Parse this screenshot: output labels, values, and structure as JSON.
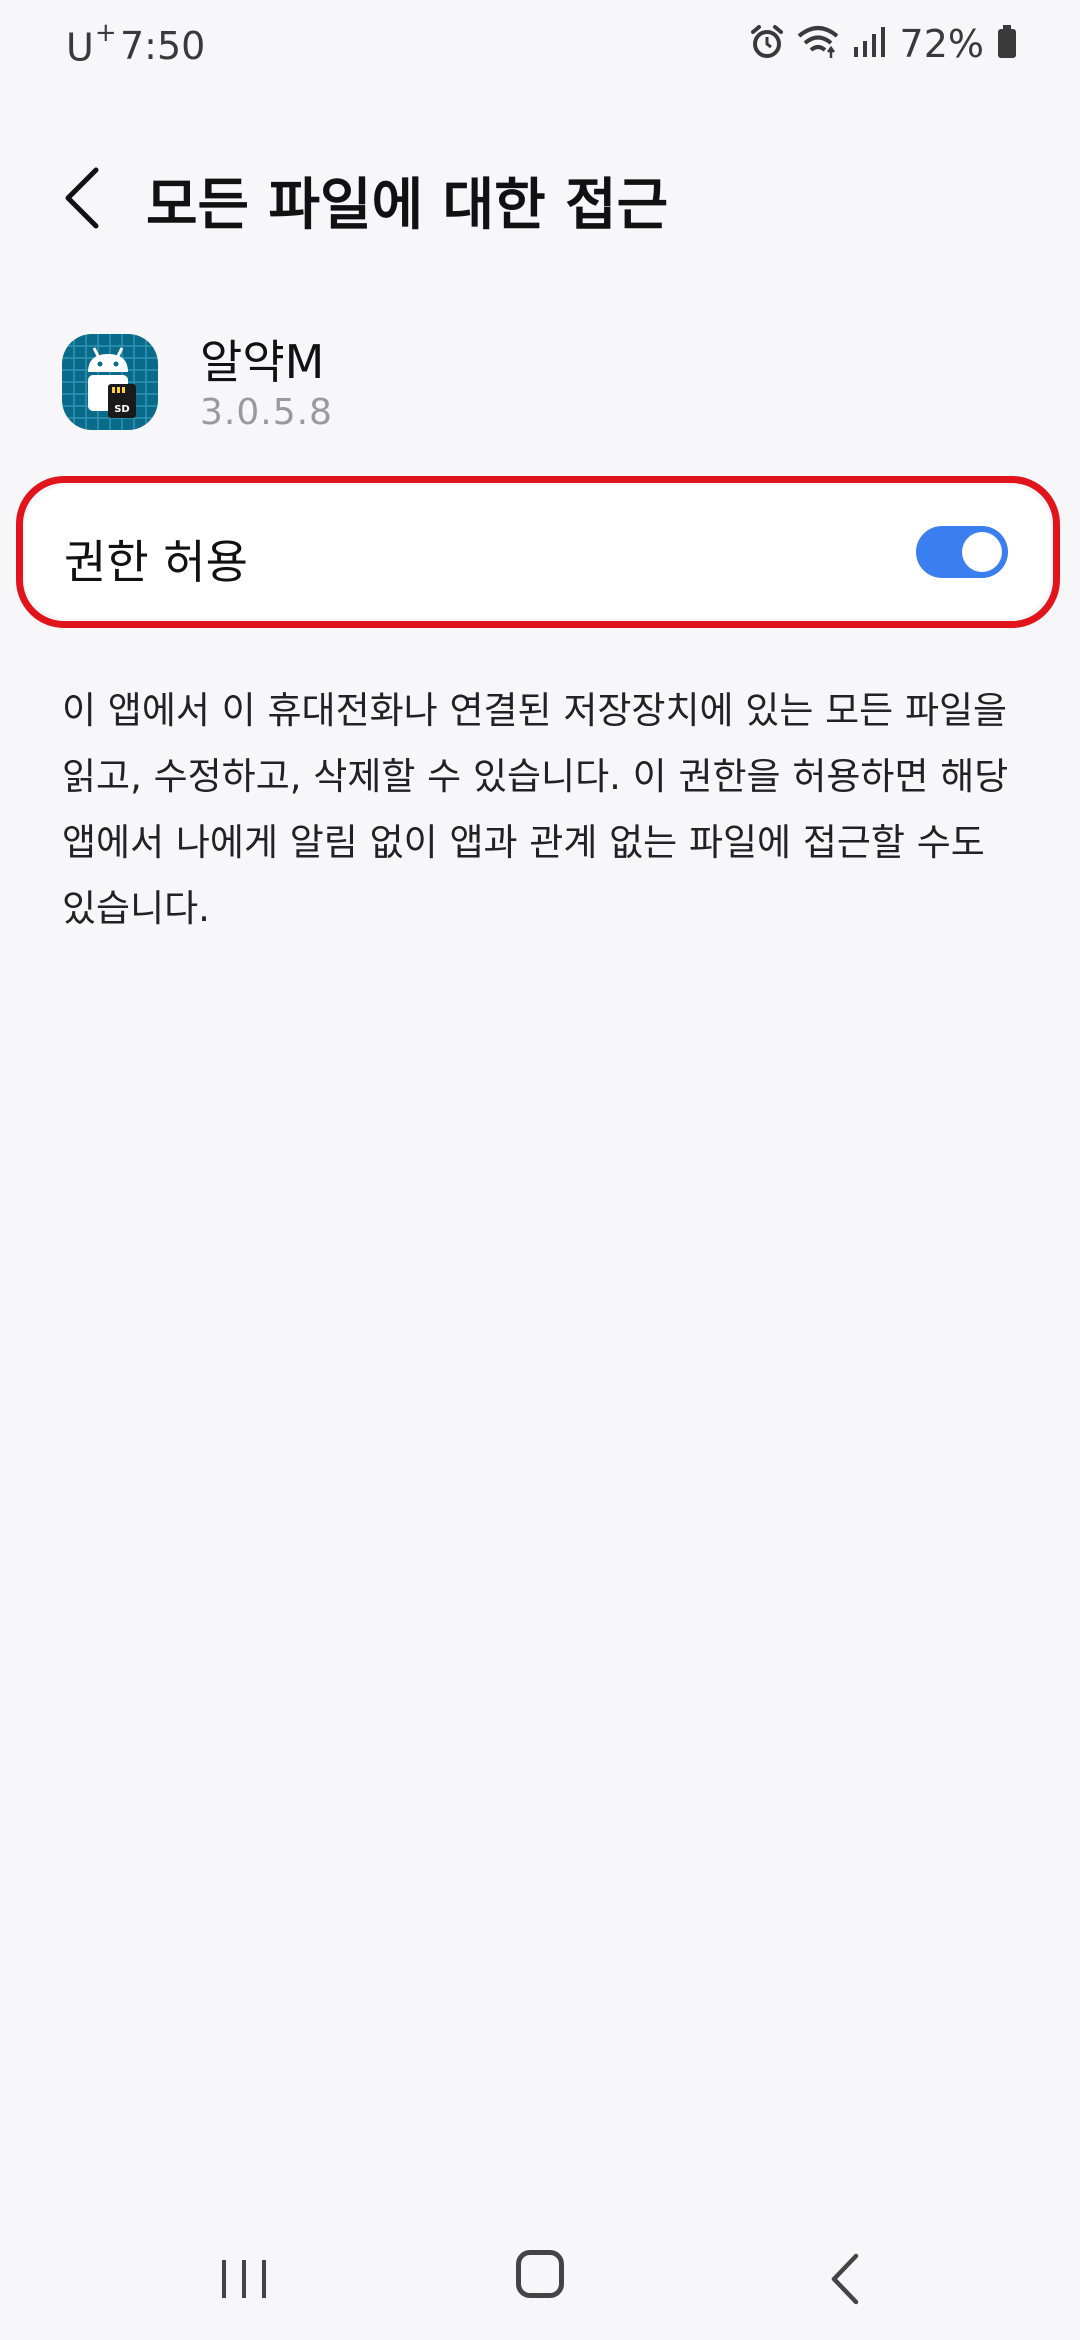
{
  "status_bar": {
    "carrier": "U",
    "carrier_suffix": "+",
    "time": "7:50",
    "battery_percent": "72%",
    "icons": [
      "alarm-icon",
      "wifi-icon",
      "signal-icon",
      "battery-icon"
    ]
  },
  "header": {
    "back_icon": "chevron-left-icon",
    "title": "모든 파일에 대한 접근"
  },
  "app": {
    "icon": "android-sd-card-icon",
    "icon_badge": "SD",
    "name": "알약M",
    "version": "3.0.5.8"
  },
  "permission": {
    "label": "권한 허용",
    "enabled": true,
    "toggle_color": "#3a7ef0",
    "highlight_color": "#e1141b"
  },
  "description": "이 앱에서 이 휴대전화나 연결된 저장장치에 있는 모든 파일을 읽고, 수정하고, 삭제할 수 있습니다. 이 권한을 허용하면 해당 앱에서 나에게 알림 없이 앱과 관계 없는 파일에 접근할 수도 있습니다.",
  "nav_bar": {
    "items": [
      "recent-apps-icon",
      "home-icon",
      "back-icon"
    ]
  }
}
